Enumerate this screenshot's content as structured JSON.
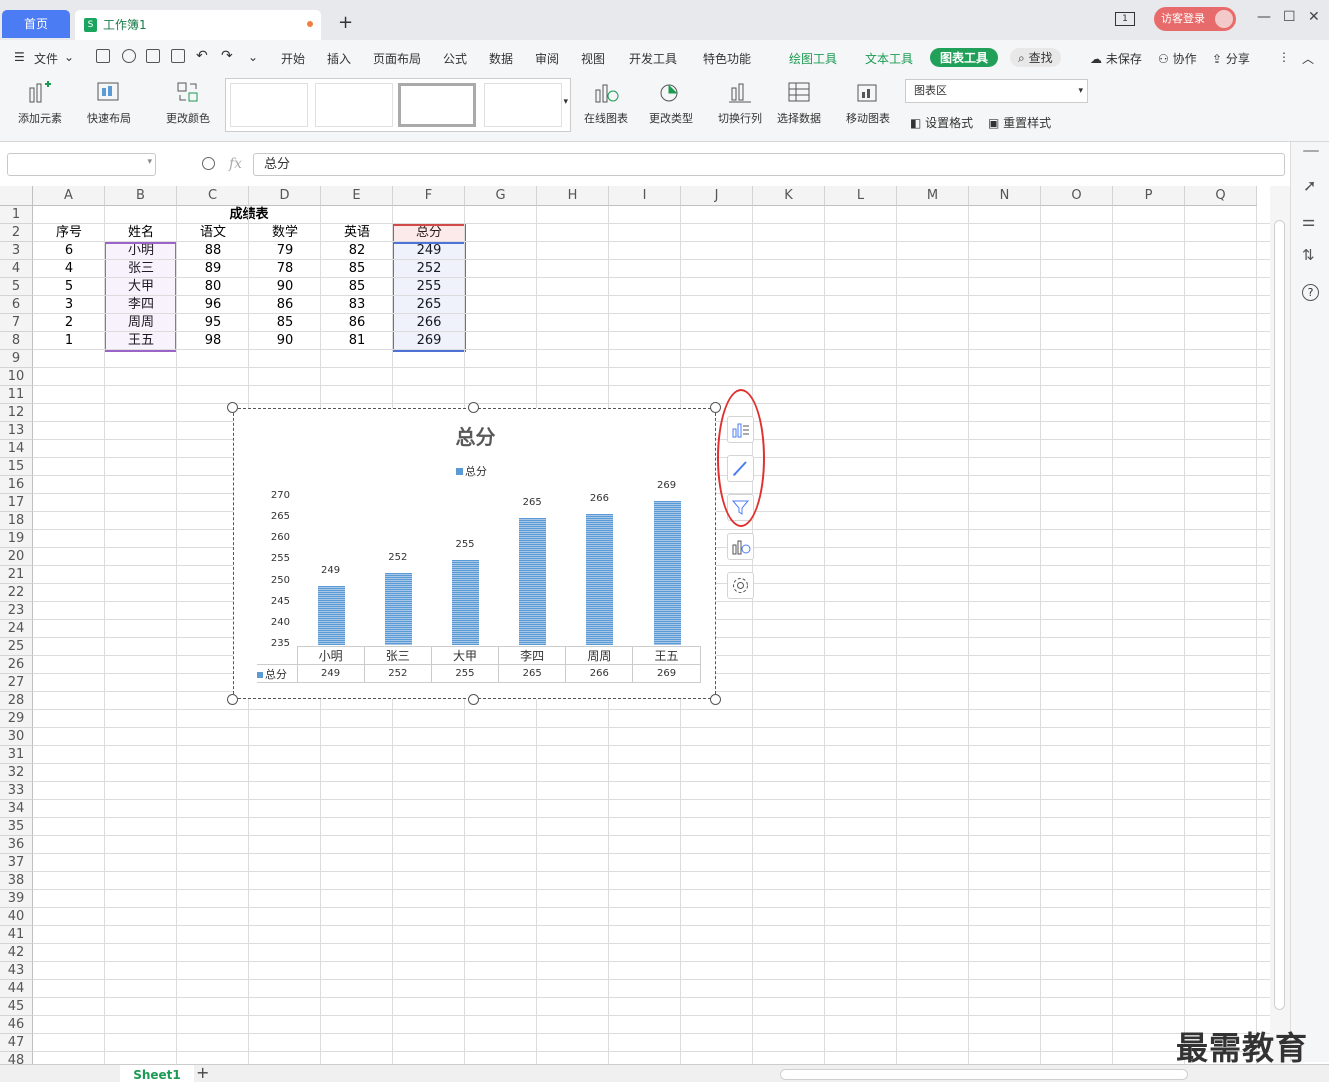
{
  "titlebar": {
    "home_tab": "首页",
    "workbook_tab": "工作簿1",
    "doc_icon_letter": "S",
    "window_badge": "1",
    "login_label": "访客登录"
  },
  "menubar": {
    "file": "文件",
    "items": [
      "开始",
      "插入",
      "页面布局",
      "公式",
      "数据",
      "审阅",
      "视图",
      "开发工具",
      "特色功能"
    ],
    "context_tabs": [
      "绘图工具",
      "文本工具",
      "图表工具"
    ],
    "search": "查找",
    "unsaved": "未保存",
    "collab": "协作",
    "share": "分享"
  },
  "ribbon": {
    "add_element": "添加元素",
    "quick_layout": "快速布局",
    "change_color": "更改颜色",
    "online_chart": "在线图表",
    "change_type": "更改类型",
    "switch_rowcol": "切换行列",
    "select_data": "选择数据",
    "move_chart": "移动图表",
    "area_select": "图表区",
    "set_format": "设置格式",
    "reset_style": "重置样式"
  },
  "formula_bar": {
    "fx": "fx",
    "content": "总分"
  },
  "columns": [
    "A",
    "B",
    "C",
    "D",
    "E",
    "F",
    "G",
    "H",
    "I",
    "J",
    "K",
    "L",
    "M",
    "N",
    "O",
    "P",
    "Q"
  ],
  "rows_count": 48,
  "spreadsheet": {
    "title": "成绩表",
    "headers": [
      "序号",
      "姓名",
      "语文",
      "数学",
      "英语",
      "总分"
    ],
    "rows": [
      [
        "6",
        "小明",
        "88",
        "79",
        "82",
        "249"
      ],
      [
        "4",
        "张三",
        "89",
        "78",
        "85",
        "252"
      ],
      [
        "5",
        "大甲",
        "80",
        "90",
        "85",
        "255"
      ],
      [
        "3",
        "李四",
        "96",
        "86",
        "83",
        "265"
      ],
      [
        "2",
        "周周",
        "95",
        "85",
        "86",
        "266"
      ],
      [
        "1",
        "王五",
        "98",
        "90",
        "81",
        "269"
      ]
    ]
  },
  "chart_data": {
    "type": "bar",
    "title": "总分",
    "legend": "top",
    "categories": [
      "小明",
      "张三",
      "大甲",
      "李四",
      "周周",
      "王五"
    ],
    "series": [
      {
        "name": "总分",
        "values": [
          249,
          252,
          255,
          265,
          266,
          269
        ],
        "color": "#5b9bd5"
      }
    ],
    "ylim": [
      235,
      270
    ],
    "yticks": [
      270,
      265,
      260,
      255,
      250,
      245,
      240,
      235
    ],
    "data_table": true
  },
  "sheet_tabs": [
    "Sheet1"
  ],
  "watermark": "最需教育"
}
